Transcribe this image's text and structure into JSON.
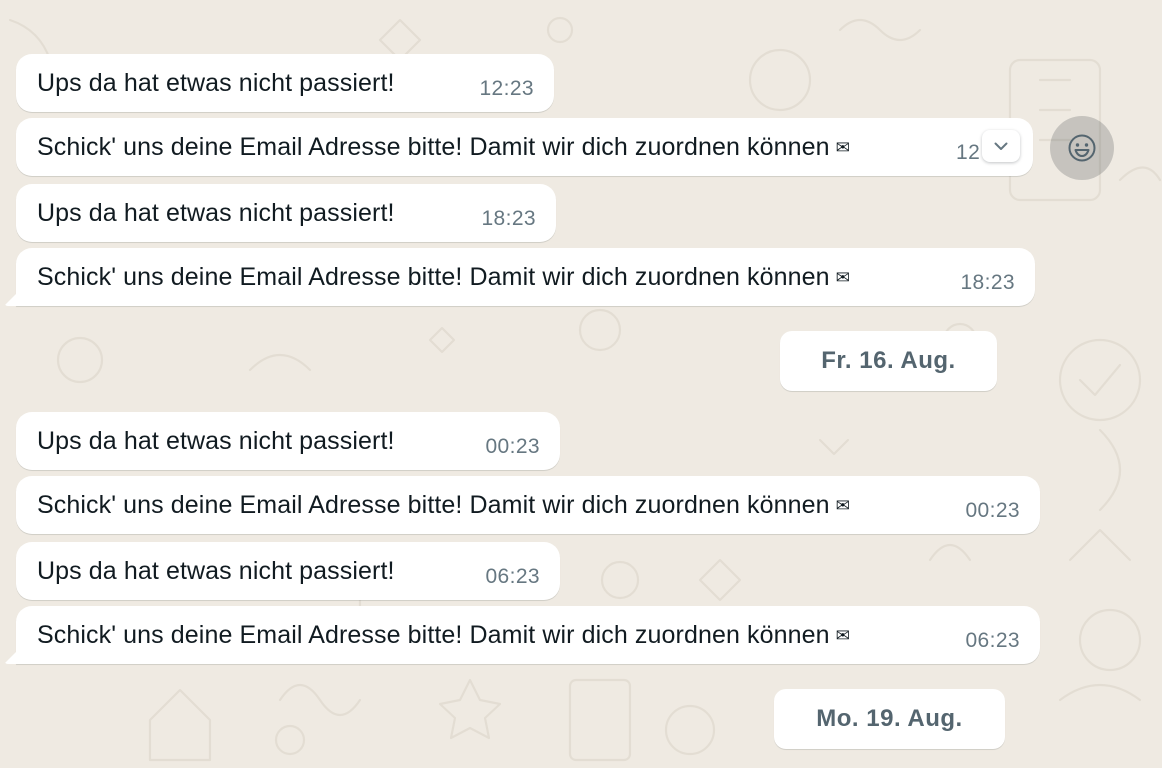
{
  "theme": {
    "background": "#efeae2",
    "bubble_incoming": "#ffffff",
    "text_primary": "#111b21",
    "text_meta": "#667781"
  },
  "messages": [
    {
      "text": "Ups da hat etwas nicht passiert!",
      "time": "12:23"
    },
    {
      "text": "Schick' uns deine Email Adresse bitte! Damit wir dich zuordnen können",
      "icon": "✉",
      "time": "12:23",
      "hovered": true
    },
    {
      "text": "Ups da hat etwas nicht passiert!",
      "time": "18:23"
    },
    {
      "text": "Schick' uns deine Email Adresse bitte! Damit wir dich zuordnen können",
      "icon": "✉",
      "time": "18:23"
    },
    {
      "text": "Ups da hat etwas nicht passiert!",
      "time": "00:23"
    },
    {
      "text": "Schick' uns deine Email Adresse bitte! Damit wir dich zuordnen können",
      "icon": "✉",
      "time": "00:23"
    },
    {
      "text": "Ups da hat etwas nicht passiert!",
      "time": "06:23"
    },
    {
      "text": "Schick' uns deine Email Adresse bitte! Damit wir dich zuordnen können",
      "icon": "✉",
      "time": "06:23"
    }
  ],
  "date_separators": [
    {
      "label": "Fr. 16. Aug."
    },
    {
      "label": "Mo. 19. Aug."
    }
  ],
  "hover_controls": {
    "menu_icon": "chevron-down-icon",
    "reaction_icon": "smiley-face-icon"
  }
}
